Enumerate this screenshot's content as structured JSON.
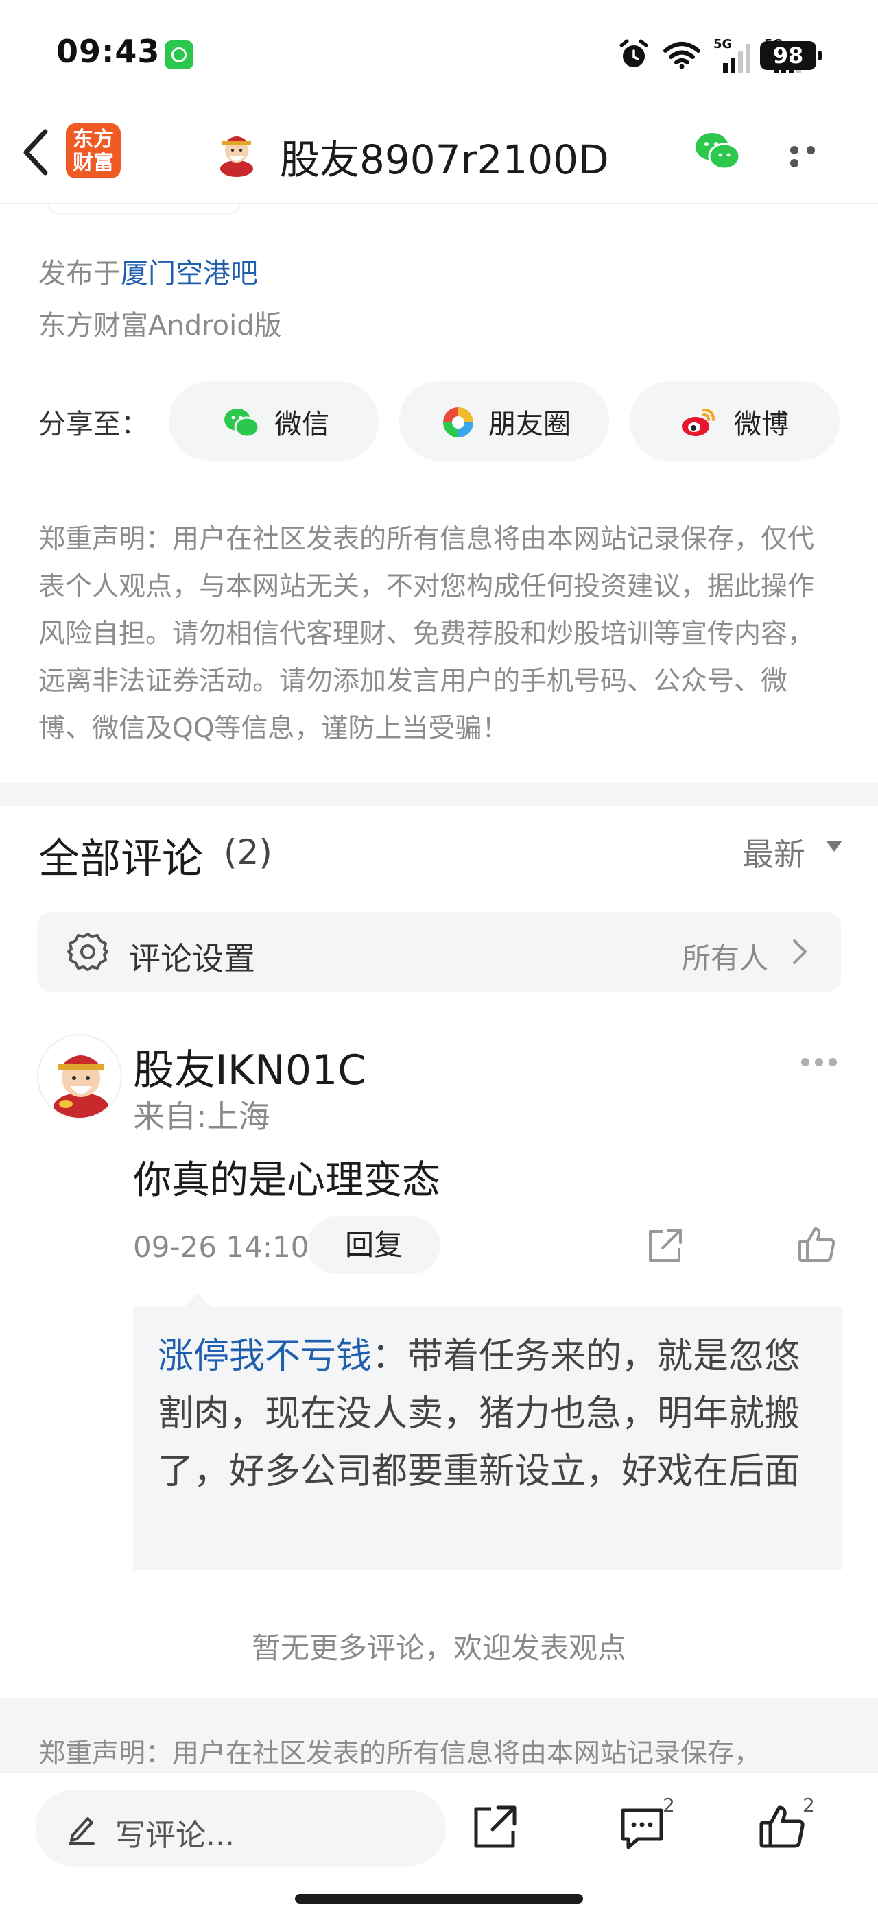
{
  "status_bar": {
    "time": "09:43",
    "battery": "98",
    "signal_label_1": "5G",
    "signal_label_2": "5G"
  },
  "header": {
    "logo_line1": "东方",
    "logo_line2": "财富",
    "title": "股友8907r2100D"
  },
  "post_meta": {
    "published_prefix": "发布于",
    "forum": "厦门空港吧",
    "source": "东方财富Android版"
  },
  "share": {
    "label": "分享至：",
    "options": [
      "微信",
      "朋友圈",
      "微博"
    ]
  },
  "disclaimer": "郑重声明：用户在社区发表的所有信息将由本网站记录保存，仅代表个人观点，与本网站无关，不对您构成任何投资建议，据此操作风险自担。请勿相信代客理财、免费荐股和炒股培训等宣传内容，远离非法证券活动。请勿添加发言用户的手机号码、公众号、微博、微信及QQ等信息，谨防上当受骗！",
  "comments": {
    "title": "全部评论",
    "count": "(2)",
    "sort": "最新",
    "settings_label": "评论设置",
    "settings_value": "所有人",
    "items": [
      {
        "user": "股友IKN01C",
        "location": "来自:上海",
        "text": "你真的是心理变态",
        "time": "09-26 14:10",
        "reply_label": "回复",
        "quote_user": "涨停我不亏钱",
        "quote_text": "：带着任务来的，就是忽悠割肉，现在没人卖，猪力也急，明年就搬了，好多公司都要重新设立，好戏在后面"
      }
    ],
    "no_more": "暂无更多评论，欢迎发表观点"
  },
  "bottom_disclaimer": "郑重声明：用户在社区发表的所有信息将由本网站记录保存，",
  "bottom_bar": {
    "write_placeholder": "写评论...",
    "comment_count": "2",
    "like_count": "2"
  },
  "colors": {
    "link": "#1f5fae",
    "logo": "#f05a24",
    "wechat": "#2bc84d"
  }
}
